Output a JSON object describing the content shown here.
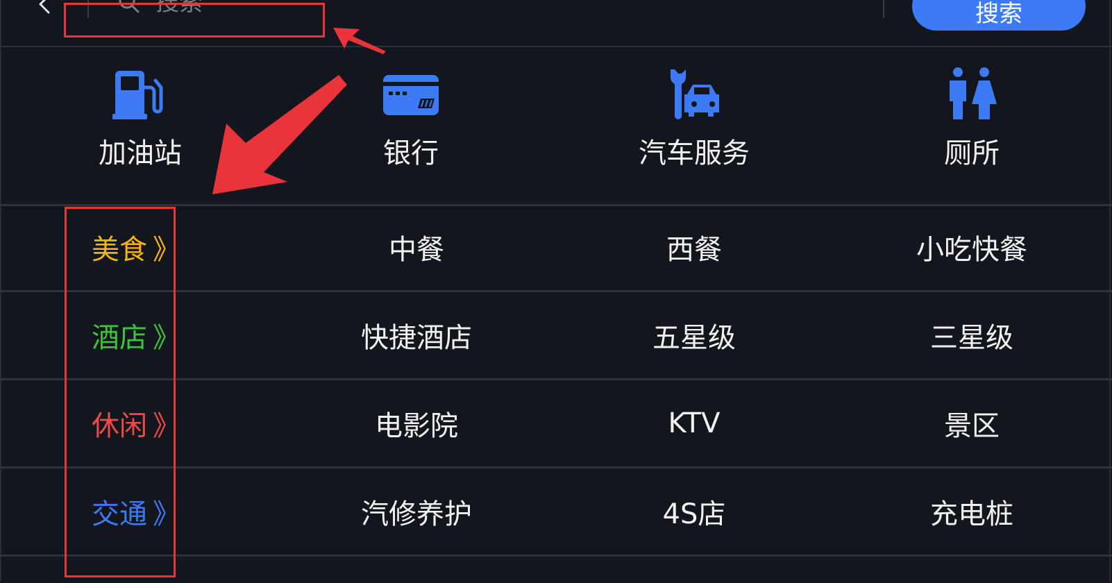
{
  "search": {
    "placeholder": "搜索",
    "button_label": "搜索"
  },
  "quick_links": [
    {
      "label": "加油站",
      "icon": "gas-station-icon"
    },
    {
      "label": "银行",
      "icon": "bank-card-icon"
    },
    {
      "label": "汽车服务",
      "icon": "car-service-icon"
    },
    {
      "label": "厕所",
      "icon": "restroom-icon"
    }
  ],
  "categories": [
    {
      "name": "美食",
      "chevron": "》",
      "color": "#f5b31a",
      "items": [
        "中餐",
        "西餐",
        "小吃快餐"
      ]
    },
    {
      "name": "酒店",
      "chevron": "》",
      "color": "#3cc53a",
      "items": [
        "快捷酒店",
        "五星级",
        "三星级"
      ]
    },
    {
      "name": "休闲",
      "chevron": "》",
      "color": "#f04a4a",
      "items": [
        "电影院",
        "KTV",
        "景区"
      ]
    },
    {
      "name": "交通",
      "chevron": "》",
      "color": "#3d7af5",
      "items": [
        "汽修养护",
        "4S店",
        "充电桩"
      ]
    }
  ],
  "colors": {
    "background": "#13161d",
    "accent": "#3d7af5",
    "annotation": "#e8343a"
  }
}
